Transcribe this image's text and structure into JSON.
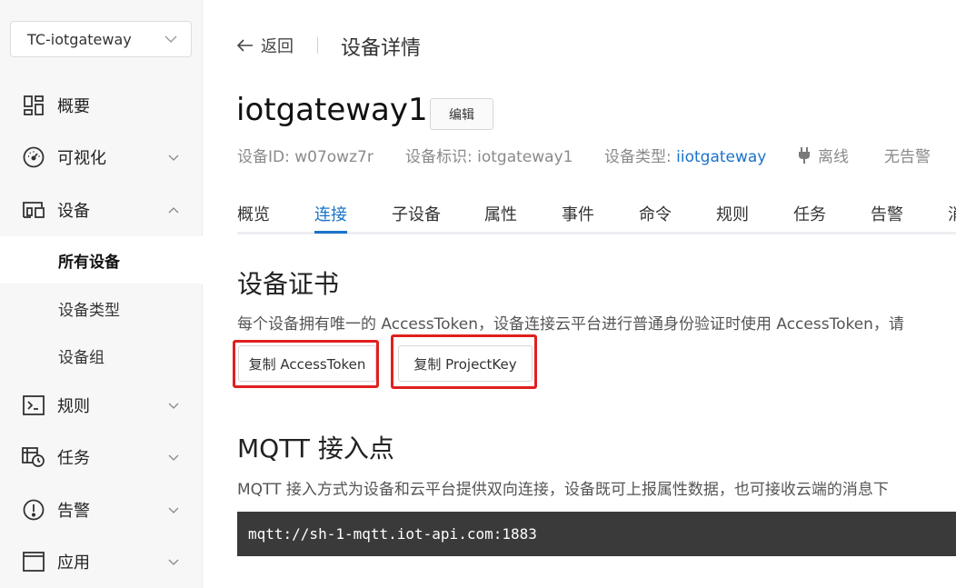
{
  "sidebar": {
    "project": "TC-iotgateway",
    "menu": [
      {
        "label": "概要",
        "icon": "dashboard-icon"
      },
      {
        "label": "可视化",
        "icon": "gauge-icon"
      },
      {
        "label": "设备",
        "icon": "devices-icon"
      },
      {
        "label": "规则",
        "icon": "terminal-icon"
      },
      {
        "label": "任务",
        "icon": "task-clock-icon"
      },
      {
        "label": "告警",
        "icon": "alert-icon"
      },
      {
        "label": "应用",
        "icon": "window-icon"
      }
    ],
    "sub_items": [
      {
        "label": "所有设备",
        "active": true
      },
      {
        "label": "设备类型"
      },
      {
        "label": "设备组"
      }
    ]
  },
  "header": {
    "back_label": "返回",
    "title": "设备详情"
  },
  "device": {
    "name": "iotgateway1",
    "edit_label": "编辑",
    "id_label": "设备ID: w07owz7r",
    "identifier_label": "设备标识: iotgateway1",
    "type_prefix": "设备类型: ",
    "type_value": "iiotgateway",
    "status": "离线",
    "alarm": "无告警"
  },
  "tabs": [
    "概览",
    "连接",
    "子设备",
    "属性",
    "事件",
    "命令",
    "规则",
    "任务",
    "告警",
    "消"
  ],
  "active_tab": "连接",
  "cert": {
    "title": "设备证书",
    "desc": "每个设备拥有唯一的 AccessToken，设备连接云平台进行普通身份验证时使用 AccessToken，请",
    "copy_token": "复制 AccessToken",
    "copy_project": "复制 ProjectKey"
  },
  "mqtt": {
    "title": "MQTT 接入点",
    "desc": "MQTT 接入方式为设备和云平台提供双向连接，设备既可上报属性数据，也可接收云端的消息下",
    "endpoint": "mqtt://sh-1-mqtt.iot-api.com:1883"
  },
  "colors": {
    "accent": "#1a73c9",
    "highlight": "#e0201f",
    "code_bg": "#3a3a3a"
  }
}
